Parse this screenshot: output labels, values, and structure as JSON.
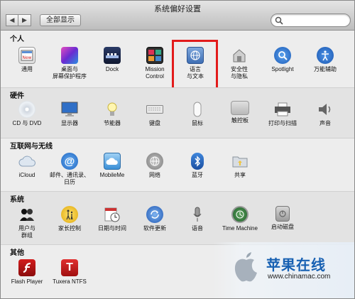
{
  "window": {
    "title": "系统偏好设置",
    "show_all_label": "全部显示",
    "back_glyph": "◀",
    "forward_glyph": "▶",
    "search_placeholder": ""
  },
  "sections": {
    "personal": {
      "title": "个人",
      "items": [
        {
          "label": "通用",
          "icon": "general-icon"
        },
        {
          "label": "桌面与",
          "label2": "屏幕保护程序",
          "icon": "desktop-screensaver-icon"
        },
        {
          "label": "Dock",
          "icon": "dock-icon"
        },
        {
          "label": "Mission",
          "label2": "Control",
          "icon": "mission-control-icon"
        },
        {
          "label": "语言",
          "label2": "与文本",
          "icon": "language-text-icon"
        },
        {
          "label": "安全性",
          "label2": "与隐私",
          "icon": "security-privacy-icon"
        },
        {
          "label": "Spotlight",
          "icon": "spotlight-icon"
        },
        {
          "label": "万能辅助",
          "icon": "universal-access-icon"
        }
      ]
    },
    "hardware": {
      "title": "硬件",
      "items": [
        {
          "label": "CD 与 DVD",
          "icon": "cd-dvd-icon"
        },
        {
          "label": "显示器",
          "icon": "displays-icon"
        },
        {
          "label": "节能器",
          "icon": "energy-saver-icon"
        },
        {
          "label": "键盘",
          "icon": "keyboard-icon"
        },
        {
          "label": "鼠标",
          "icon": "mouse-icon"
        },
        {
          "label": "触控板",
          "icon": "trackpad-icon"
        },
        {
          "label": "打印与扫描",
          "icon": "print-scan-icon"
        },
        {
          "label": "声音",
          "icon": "sound-icon"
        }
      ]
    },
    "internet": {
      "title": "互联网与无线",
      "items": [
        {
          "label": "iCloud",
          "icon": "icloud-icon"
        },
        {
          "label": "邮件、通讯录、",
          "label2": "日历",
          "icon": "mail-contacts-calendars-icon"
        },
        {
          "label": "MobileMe",
          "icon": "mobileme-icon"
        },
        {
          "label": "网络",
          "icon": "network-icon"
        },
        {
          "label": "蓝牙",
          "icon": "bluetooth-icon"
        },
        {
          "label": "共享",
          "icon": "sharing-icon"
        }
      ]
    },
    "system": {
      "title": "系统",
      "items": [
        {
          "label": "用户与",
          "label2": "群组",
          "icon": "users-groups-icon"
        },
        {
          "label": "家长控制",
          "icon": "parental-controls-icon"
        },
        {
          "label": "日期与时间",
          "icon": "date-time-icon"
        },
        {
          "label": "软件更新",
          "icon": "software-update-icon"
        },
        {
          "label": "语音",
          "icon": "speech-icon"
        },
        {
          "label": "Time Machine",
          "icon": "time-machine-icon"
        },
        {
          "label": "启动磁盘",
          "icon": "startup-disk-icon"
        }
      ]
    },
    "other": {
      "title": "其他",
      "items": [
        {
          "label": "Flash Player",
          "icon": "flash-player-icon"
        },
        {
          "label": "Tuxera NTFS",
          "icon": "tuxera-ntfs-icon"
        }
      ]
    }
  },
  "watermark": {
    "title": "苹果在线",
    "url": "www.chinamac.com"
  },
  "colors": {
    "highlight": "#e21b1b",
    "watermark_text": "#1760b2"
  }
}
